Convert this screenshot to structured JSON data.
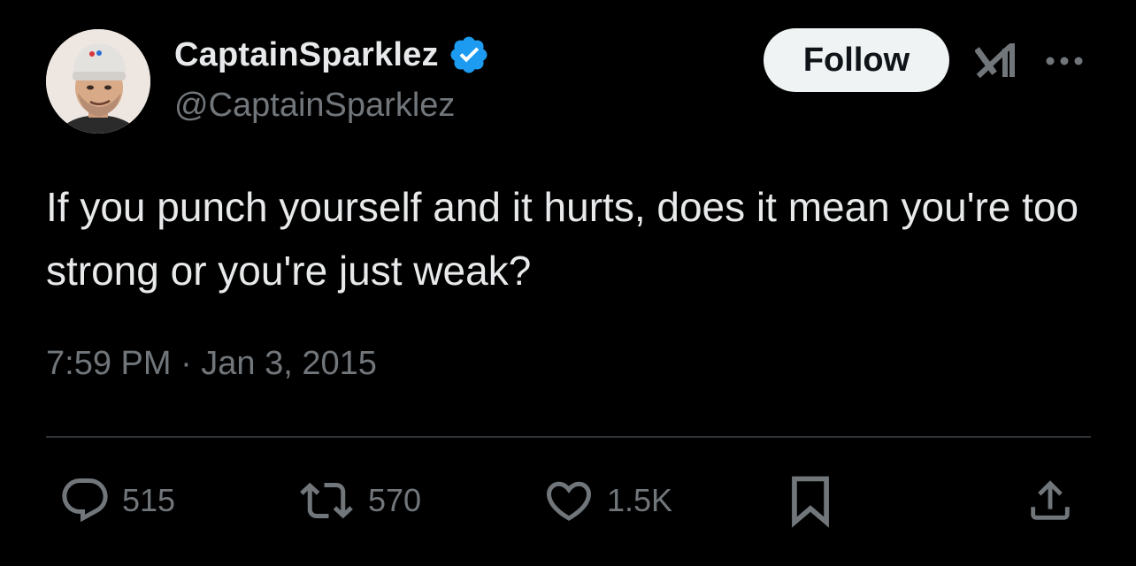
{
  "author": {
    "display_name": "CaptainSparklez",
    "handle": "@CaptainSparklez",
    "verified": true,
    "verified_color": "#1d9bf0"
  },
  "header": {
    "follow_label": "Follow",
    "grok_icon": "grok-icon",
    "more_icon": "more-horizontal-icon"
  },
  "tweet": {
    "text": "If you punch yourself and it hurts, does it mean you're too strong or you're just weak?",
    "timestamp": "7:59 PM · Jan 3, 2015"
  },
  "actions": {
    "replies": "515",
    "retweets": "570",
    "likes": "1.5K"
  },
  "colors": {
    "background": "#000000",
    "text_primary": "#e7e9ea",
    "text_secondary": "#71767b",
    "follow_bg": "#eff3f4",
    "divider": "#2f3336"
  }
}
